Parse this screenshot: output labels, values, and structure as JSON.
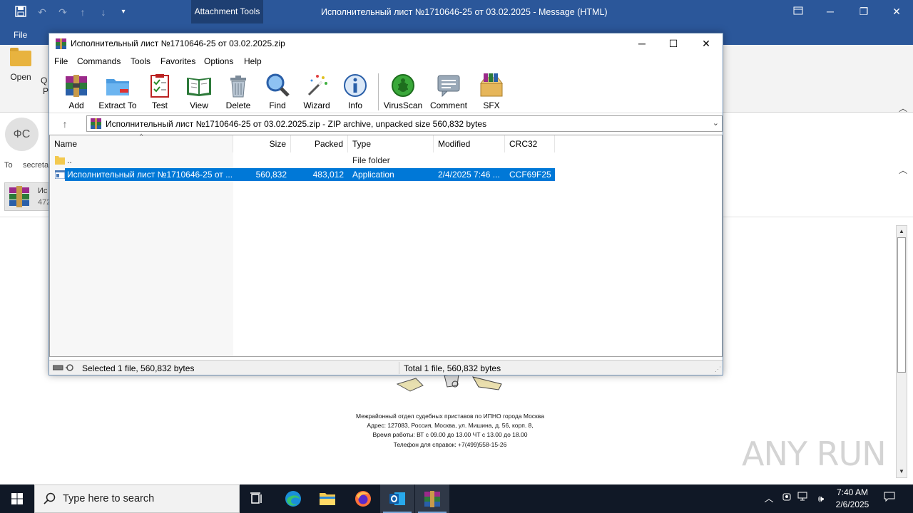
{
  "outlook": {
    "attachment_tools": "Attachment Tools",
    "window_title": "Исполнительный лист №1710646-25 от 03.02.2025  -  Message (HTML)",
    "file_tab": "File",
    "open_label": "Open",
    "q_label": "Q",
    "p_label": "P",
    "avatar_initials": "ФС",
    "to_label": "To",
    "to_value": "secreta",
    "attachment_name": "Ис",
    "attachment_size": "472",
    "doc_lines": [
      "Межрайонный отдел судебных приставов по ИПНО города Москва",
      "Адрес: 127083, Россия, Москва, ул. Мишина, д. 56, корп. 8,",
      "Время работы: ВТ с 09.00 до 13.00 ЧТ с 13.00 до 18.00",
      "Телефон для справок: +7(499)558-15-26"
    ],
    "watermark": "ANY RUN"
  },
  "winrar": {
    "title": "Исполнительный лист №1710646-25 от 03.02.2025.zip",
    "menu": [
      "File",
      "Commands",
      "Tools",
      "Favorites",
      "Options",
      "Help"
    ],
    "tools": [
      {
        "label": "Add",
        "icon": "add-archive-icon"
      },
      {
        "label": "Extract To",
        "icon": "extract-folder-icon"
      },
      {
        "label": "Test",
        "icon": "test-clipboard-icon"
      },
      {
        "label": "View",
        "icon": "view-book-icon"
      },
      {
        "label": "Delete",
        "icon": "delete-trash-icon"
      },
      {
        "label": "Find",
        "icon": "find-magnifier-icon"
      },
      {
        "label": "Wizard",
        "icon": "wizard-wand-icon"
      },
      {
        "label": "Info",
        "icon": "info-icon"
      },
      {
        "label": "VirusScan",
        "icon": "virus-scan-icon"
      },
      {
        "label": "Comment",
        "icon": "comment-icon"
      },
      {
        "label": "SFX",
        "icon": "sfx-box-icon"
      }
    ],
    "path": "Исполнительный лист №1710646-25 от 03.02.2025.zip - ZIP archive, unpacked size 560,832 bytes",
    "columns": [
      "Name",
      "Size",
      "Packed",
      "Type",
      "Modified",
      "CRC32"
    ],
    "rows": [
      {
        "name": "..",
        "size": "",
        "packed": "",
        "type": "File folder",
        "modified": "",
        "crc": ""
      },
      {
        "name": "Исполнительный лист №1710646-25 от ...",
        "size": "560,832",
        "packed": "483,012",
        "type": "Application",
        "modified": "2/4/2025 7:46 ...",
        "crc": "CCF69F25"
      }
    ],
    "status_left": "Selected 1 file, 560,832 bytes",
    "status_right": "Total 1 file, 560,832 bytes"
  },
  "taskbar": {
    "search_placeholder": "Type here to search",
    "time": "7:40 AM",
    "date": "2/6/2025"
  },
  "colors": {
    "outlook_blue": "#2b579a",
    "selection_blue": "#0078d7",
    "taskbar": "#101826"
  }
}
